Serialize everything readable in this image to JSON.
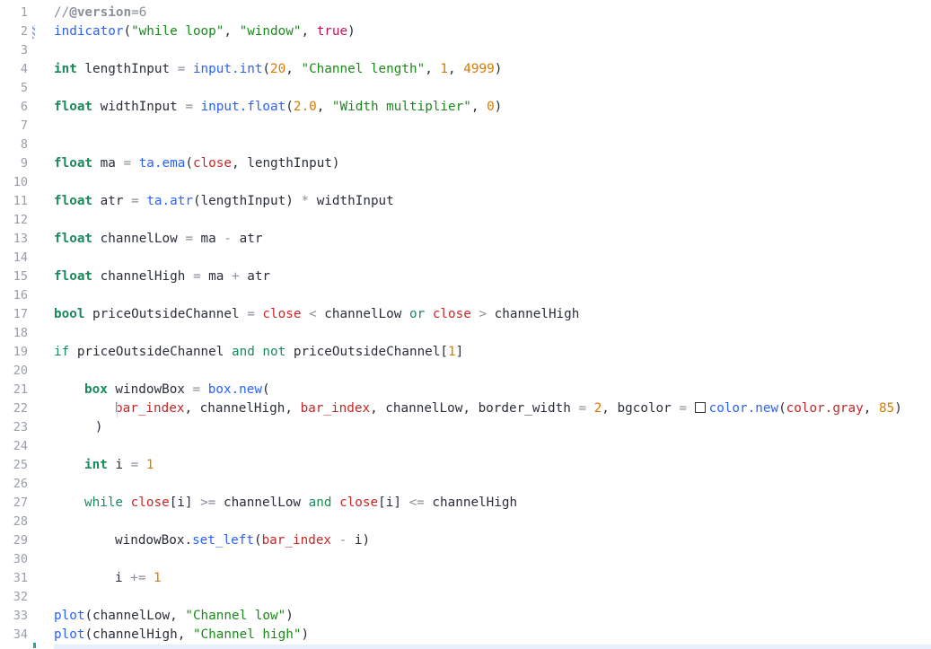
{
  "editor": {
    "lines": [
      {
        "n": "1",
        "indent": 0,
        "tokens": [
          [
            "comment",
            "//"
          ],
          [
            "bold",
            "@version"
          ],
          [
            "comment",
            "=6"
          ]
        ]
      },
      {
        "n": "2",
        "indent": 0,
        "tokens": [
          [
            "fn",
            "indicator"
          ],
          [
            "punct",
            "("
          ],
          [
            "str",
            "\"while loop\""
          ],
          [
            "punct",
            ", "
          ],
          [
            "str",
            "\"window\""
          ],
          [
            "punct",
            ", "
          ],
          [
            "bool",
            "true"
          ],
          [
            "punct",
            ")"
          ]
        ]
      },
      {
        "n": "3",
        "indent": 0,
        "tokens": []
      },
      {
        "n": "4",
        "indent": 0,
        "tokens": [
          [
            "type",
            "int"
          ],
          [
            "punct",
            " lengthInput "
          ],
          [
            "op",
            "="
          ],
          [
            "punct",
            " "
          ],
          [
            "fn",
            "input.int"
          ],
          [
            "punct",
            "("
          ],
          [
            "num",
            "20"
          ],
          [
            "punct",
            ", "
          ],
          [
            "str",
            "\"Channel length\""
          ],
          [
            "punct",
            ", "
          ],
          [
            "num",
            "1"
          ],
          [
            "punct",
            ", "
          ],
          [
            "num",
            "4999"
          ],
          [
            "punct",
            ")"
          ]
        ]
      },
      {
        "n": "5",
        "indent": 0,
        "tokens": []
      },
      {
        "n": "6",
        "indent": 0,
        "tokens": [
          [
            "type",
            "float"
          ],
          [
            "punct",
            " widthInput "
          ],
          [
            "op",
            "="
          ],
          [
            "punct",
            " "
          ],
          [
            "fn",
            "input.float"
          ],
          [
            "punct",
            "("
          ],
          [
            "num",
            "2.0"
          ],
          [
            "punct",
            ", "
          ],
          [
            "str",
            "\"Width multiplier\""
          ],
          [
            "punct",
            ", "
          ],
          [
            "num",
            "0"
          ],
          [
            "punct",
            ")"
          ]
        ]
      },
      {
        "n": "7",
        "indent": 0,
        "tokens": []
      },
      {
        "n": "8",
        "indent": 0,
        "tokens": []
      },
      {
        "n": "9",
        "indent": 0,
        "tokens": [
          [
            "type",
            "float"
          ],
          [
            "punct",
            " ma "
          ],
          [
            "op",
            "="
          ],
          [
            "punct",
            " "
          ],
          [
            "fn",
            "ta.ema"
          ],
          [
            "punct",
            "("
          ],
          [
            "var",
            "close"
          ],
          [
            "punct",
            ", lengthInput)"
          ]
        ]
      },
      {
        "n": "10",
        "indent": 0,
        "tokens": []
      },
      {
        "n": "11",
        "indent": 0,
        "tokens": [
          [
            "type",
            "float"
          ],
          [
            "punct",
            " atr "
          ],
          [
            "op",
            "="
          ],
          [
            "punct",
            " "
          ],
          [
            "fn",
            "ta.atr"
          ],
          [
            "punct",
            "(lengthInput) "
          ],
          [
            "op",
            "*"
          ],
          [
            "punct",
            " widthInput"
          ]
        ]
      },
      {
        "n": "12",
        "indent": 0,
        "tokens": []
      },
      {
        "n": "13",
        "indent": 0,
        "tokens": [
          [
            "type",
            "float"
          ],
          [
            "punct",
            " channelLow "
          ],
          [
            "op",
            "="
          ],
          [
            "punct",
            " ma "
          ],
          [
            "op",
            "-"
          ],
          [
            "punct",
            " atr"
          ]
        ]
      },
      {
        "n": "14",
        "indent": 0,
        "tokens": []
      },
      {
        "n": "15",
        "indent": 0,
        "tokens": [
          [
            "type",
            "float"
          ],
          [
            "punct",
            " channelHigh "
          ],
          [
            "op",
            "="
          ],
          [
            "punct",
            " ma "
          ],
          [
            "op",
            "+"
          ],
          [
            "punct",
            " atr"
          ]
        ]
      },
      {
        "n": "16",
        "indent": 0,
        "tokens": []
      },
      {
        "n": "17",
        "indent": 0,
        "tokens": [
          [
            "type",
            "bool"
          ],
          [
            "punct",
            " priceOutsideChannel "
          ],
          [
            "op",
            "="
          ],
          [
            "punct",
            " "
          ],
          [
            "var",
            "close"
          ],
          [
            "punct",
            " "
          ],
          [
            "op",
            "<"
          ],
          [
            "punct",
            " channelLow "
          ],
          [
            "kw",
            "or"
          ],
          [
            "punct",
            " "
          ],
          [
            "var",
            "close"
          ],
          [
            "punct",
            " "
          ],
          [
            "op",
            ">"
          ],
          [
            "punct",
            " channelHigh"
          ]
        ]
      },
      {
        "n": "18",
        "indent": 0,
        "tokens": []
      },
      {
        "n": "19",
        "indent": 0,
        "tokens": [
          [
            "kw",
            "if"
          ],
          [
            "punct",
            " priceOutsideChannel "
          ],
          [
            "kw",
            "and"
          ],
          [
            "punct",
            " "
          ],
          [
            "kw",
            "not"
          ],
          [
            "punct",
            " priceOutsideChannel["
          ],
          [
            "num",
            "1"
          ],
          [
            "punct",
            "]"
          ]
        ]
      },
      {
        "n": "20",
        "indent": 0,
        "tokens": []
      },
      {
        "n": "21",
        "indent": 1,
        "tokens": [
          [
            "type",
            "box"
          ],
          [
            "punct",
            " windowBox "
          ],
          [
            "op",
            "="
          ],
          [
            "punct",
            " "
          ],
          [
            "fn",
            "box.new"
          ],
          [
            "punct",
            "("
          ]
        ]
      },
      {
        "n": "22",
        "indent": 2,
        "tokens": [
          [
            "var",
            "bar_index"
          ],
          [
            "punct",
            ", channelHigh, "
          ],
          [
            "var",
            "bar_index"
          ],
          [
            "punct",
            ", channelLow, border_width "
          ],
          [
            "op",
            "="
          ],
          [
            "punct",
            " "
          ],
          [
            "num",
            "2"
          ],
          [
            "punct",
            ", bgcolor "
          ],
          [
            "op",
            "="
          ],
          [
            "punct",
            " "
          ],
          [
            "swatch",
            ""
          ],
          [
            "fn",
            "color.new"
          ],
          [
            "punct",
            "("
          ],
          [
            "var",
            "color.gray"
          ],
          [
            "punct",
            ", "
          ],
          [
            "num",
            "85"
          ],
          [
            "punct",
            ")"
          ]
        ]
      },
      {
        "n": "23",
        "indent": 1.35,
        "tokens": [
          [
            "punct",
            ")"
          ]
        ]
      },
      {
        "n": "24",
        "indent": 0,
        "tokens": []
      },
      {
        "n": "25",
        "indent": 1,
        "tokens": [
          [
            "type",
            "int"
          ],
          [
            "punct",
            " i "
          ],
          [
            "op",
            "="
          ],
          [
            "punct",
            " "
          ],
          [
            "num",
            "1"
          ]
        ]
      },
      {
        "n": "26",
        "indent": 0,
        "tokens": []
      },
      {
        "n": "27",
        "indent": 1,
        "tokens": [
          [
            "kw",
            "while"
          ],
          [
            "punct",
            " "
          ],
          [
            "var",
            "close"
          ],
          [
            "punct",
            "[i] "
          ],
          [
            "op",
            ">="
          ],
          [
            "punct",
            " channelLow "
          ],
          [
            "kw",
            "and"
          ],
          [
            "punct",
            " "
          ],
          [
            "var",
            "close"
          ],
          [
            "punct",
            "[i] "
          ],
          [
            "op",
            "<="
          ],
          [
            "punct",
            " channelHigh"
          ]
        ]
      },
      {
        "n": "28",
        "indent": 0,
        "tokens": []
      },
      {
        "n": "29",
        "indent": 2,
        "tokens": [
          [
            "punct",
            "windowBox."
          ],
          [
            "fn",
            "set_left"
          ],
          [
            "punct",
            "("
          ],
          [
            "var",
            "bar_index"
          ],
          [
            "punct",
            " "
          ],
          [
            "op",
            "-"
          ],
          [
            "punct",
            " i)"
          ]
        ]
      },
      {
        "n": "30",
        "indent": 0,
        "tokens": []
      },
      {
        "n": "31",
        "indent": 2,
        "tokens": [
          [
            "punct",
            "i "
          ],
          [
            "op",
            "+="
          ],
          [
            "punct",
            " "
          ],
          [
            "num",
            "1"
          ]
        ]
      },
      {
        "n": "32",
        "indent": 0,
        "tokens": []
      },
      {
        "n": "33",
        "indent": 0,
        "tokens": [
          [
            "fn",
            "plot"
          ],
          [
            "punct",
            "(channelLow, "
          ],
          [
            "str",
            "\"Channel low\""
          ],
          [
            "punct",
            ")"
          ]
        ]
      },
      {
        "n": "34",
        "indent": 0,
        "tokens": [
          [
            "fn",
            "plot"
          ],
          [
            "punct",
            "(channelHigh, "
          ],
          [
            "str",
            "\"Channel high\""
          ],
          [
            "punct",
            ")"
          ]
        ]
      }
    ]
  }
}
